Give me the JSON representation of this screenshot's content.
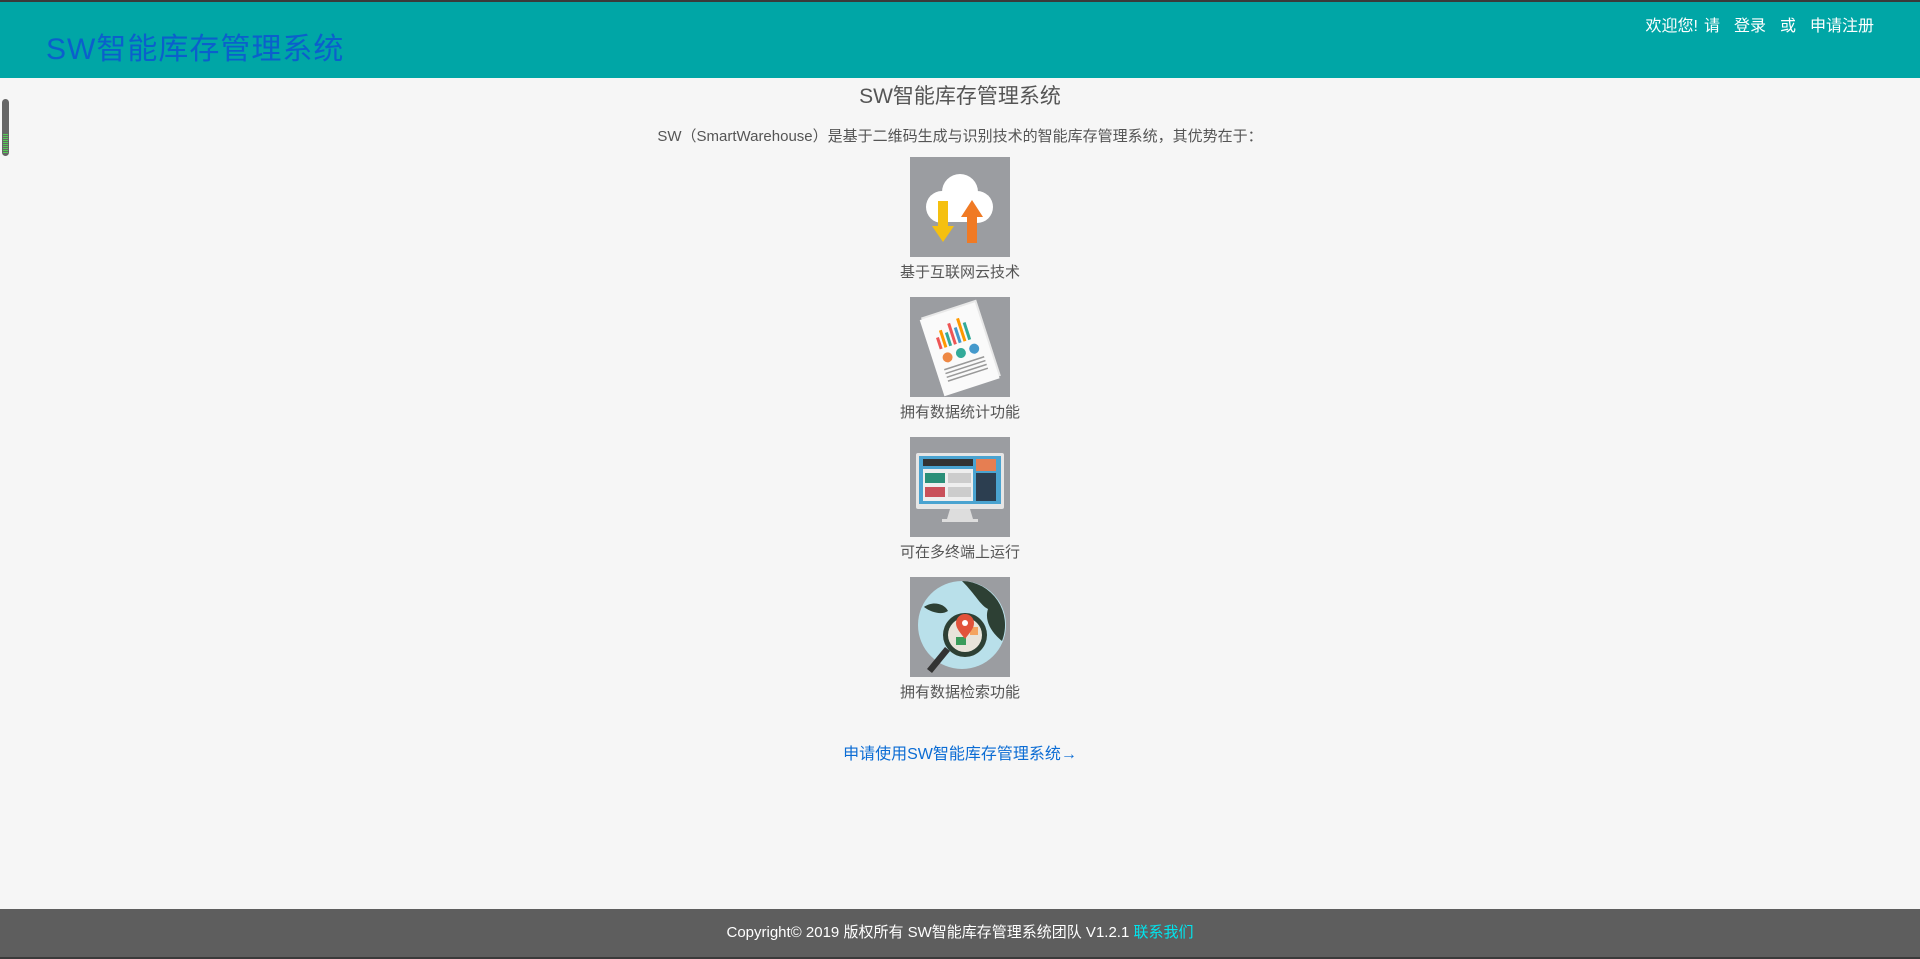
{
  "header": {
    "brand": "SW智能库存管理系统",
    "welcome": "欢迎您!",
    "please": "请",
    "login": "登录",
    "or": "或",
    "register": "申请注册"
  },
  "main": {
    "title": "SW智能库存管理系统",
    "description": "SW（SmartWarehouse）是基于二维码生成与识别技术的智能库存管理系统，其优势在于：",
    "features": [
      {
        "label": "基于互联网云技术",
        "icon": "cloud-upload-download-icon"
      },
      {
        "label": "拥有数据统计功能",
        "icon": "report-chart-icon"
      },
      {
        "label": "可在多终端上运行",
        "icon": "monitor-icon"
      },
      {
        "label": "拥有数据检索功能",
        "icon": "globe-search-icon"
      }
    ],
    "apply_link": "申请使用SW智能库存管理系统→"
  },
  "footer": {
    "copyright": "Copyright© 2019 版权所有 SW智能库存管理系统团队 V1.2.1 ",
    "contact": "联系我们"
  },
  "colors": {
    "header_bg": "#00a6a6",
    "brand": "#0b5fcc",
    "link": "#0b6cd4",
    "footer_bg": "#5e5e5e",
    "contact": "#00e5ee"
  }
}
